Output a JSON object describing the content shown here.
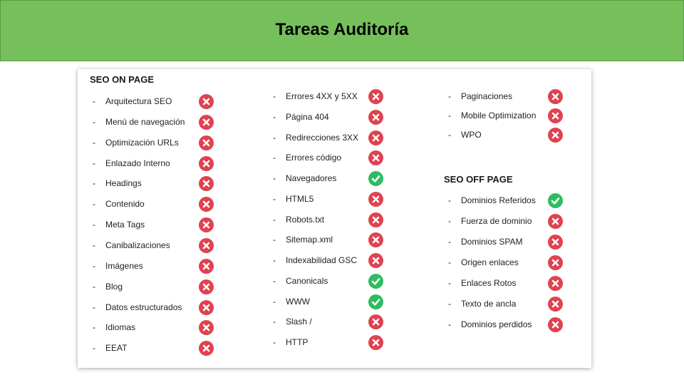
{
  "title": "Tareas Auditoría",
  "colors": {
    "banner": "#76c05b",
    "fail": "#e0424f",
    "pass": "#2ebc61"
  },
  "sections": {
    "on_page_title": "SEO ON PAGE",
    "off_page_title": "SEO OFF PAGE"
  },
  "columns": [
    {
      "items": [
        {
          "label": "Arquitectura SEO",
          "status": "fail"
        },
        {
          "label": "Menú de navegación",
          "status": "fail"
        },
        {
          "label": "Optimización URLs",
          "status": "fail"
        },
        {
          "label": "Enlazado Interno",
          "status": "fail"
        },
        {
          "label": "Headings",
          "status": "fail"
        },
        {
          "label": "Contenido",
          "status": "fail"
        },
        {
          "label": "Meta Tags",
          "status": "fail"
        },
        {
          "label": "Canibalizaciones",
          "status": "fail"
        },
        {
          "label": "Imágenes",
          "status": "fail"
        },
        {
          "label": "Blog",
          "status": "fail"
        },
        {
          "label": "Datos estructurados",
          "status": "fail"
        },
        {
          "label": "Idiomas",
          "status": "fail"
        },
        {
          "label": "EEAT",
          "status": "fail"
        }
      ]
    },
    {
      "items": [
        {
          "label": "Errores 4XX y 5XX",
          "status": "fail"
        },
        {
          "label": "Página 404",
          "status": "fail"
        },
        {
          "label": "Redirecciones 3XX",
          "status": "fail"
        },
        {
          "label": "Errores código",
          "status": "fail"
        },
        {
          "label": "Navegadores",
          "status": "pass"
        },
        {
          "label": "HTML5",
          "status": "fail"
        },
        {
          "label": "Robots.txt",
          "status": "fail"
        },
        {
          "label": "Sitemap.xml",
          "status": "fail"
        },
        {
          "label": "Indexabilidad GSC",
          "status": "fail"
        },
        {
          "label": "Canonicals",
          "status": "pass"
        },
        {
          "label": "WWW",
          "status": "pass"
        },
        {
          "label": "Slash /",
          "status": "fail"
        },
        {
          "label": "HTTP",
          "status": "fail"
        }
      ]
    },
    {
      "items": [
        {
          "label": "Paginaciones",
          "status": "fail"
        },
        {
          "label": "Mobile Optimization",
          "status": "fail"
        },
        {
          "label": "WPO",
          "status": "fail"
        }
      ]
    },
    {
      "items": [
        {
          "label": "Dominios Referidos",
          "status": "pass"
        },
        {
          "label": "Fuerza de dominio",
          "status": "fail"
        },
        {
          "label": "Dominios SPAM",
          "status": "fail"
        },
        {
          "label": "Origen enlaces",
          "status": "fail"
        },
        {
          "label": "Enlaces Rotos",
          "status": "fail"
        },
        {
          "label": "Texto de ancla",
          "status": "fail"
        },
        {
          "label": "Dominios perdidos",
          "status": "fail"
        }
      ]
    }
  ]
}
